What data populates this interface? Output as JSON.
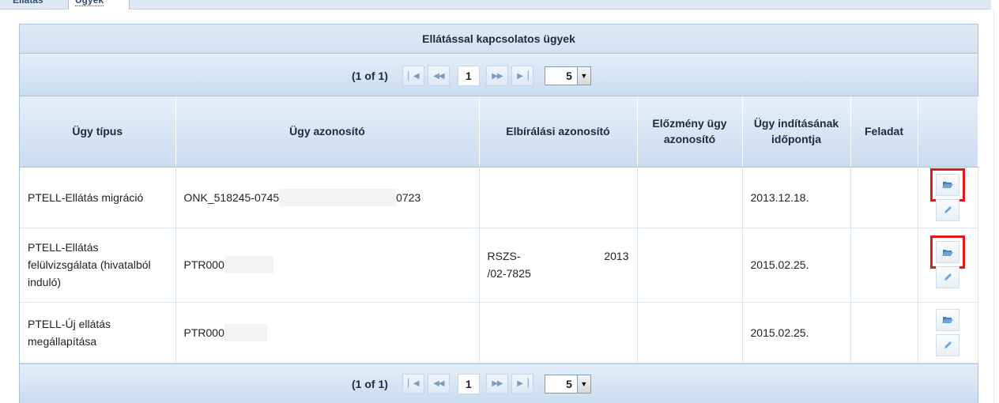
{
  "tabs": [
    {
      "label": "Ellátás"
    },
    {
      "label": "Ügyek"
    }
  ],
  "panel": {
    "caption": "Ellátással kapcsolatos ügyek"
  },
  "paginator": {
    "count": "(1 of 1)",
    "page": "1",
    "rows_per_page": "5",
    "first_icon": "first-page-icon",
    "prev_icon": "prev-page-icon",
    "next_icon": "next-page-icon",
    "last_icon": "last-page-icon"
  },
  "columns": [
    "Ügy típus",
    "Ügy azonosító",
    "Elbírálási azonosító",
    "Előzmény ügy azonosító",
    "Ügy indításának időpontja",
    "Feladat",
    ""
  ],
  "rows": [
    {
      "type": "PTELL-Ellátás migráció",
      "id": "ONK_518245-0745",
      "id_tail": "0723",
      "decision_id": "",
      "prev_id": "",
      "date": "2013.12.18.",
      "task": ""
    },
    {
      "type": "PTELL-Ellátás felülvizsgálata (hivatalból induló)",
      "id": "PTR000",
      "id_tail": "",
      "decision_id_part1": "RSZS-",
      "decision_id_part2": "2013",
      "decision_id_part3": "/02-7825",
      "prev_id": "",
      "date": "2015.02.25.",
      "task": ""
    },
    {
      "type": "PTELL-Új ellátás megállapítása",
      "id": "PTR000",
      "id_tail": "",
      "decision_id": "",
      "prev_id": "",
      "date": "2015.02.25.",
      "task": ""
    }
  ],
  "icons": {
    "open": "folder-open-icon",
    "edit": "pencil-icon"
  },
  "colors": {
    "header_bg": "#cadcf0",
    "border": "#a9c3df",
    "highlight": "#e0191e",
    "icon_blue": "#3d85c6"
  }
}
